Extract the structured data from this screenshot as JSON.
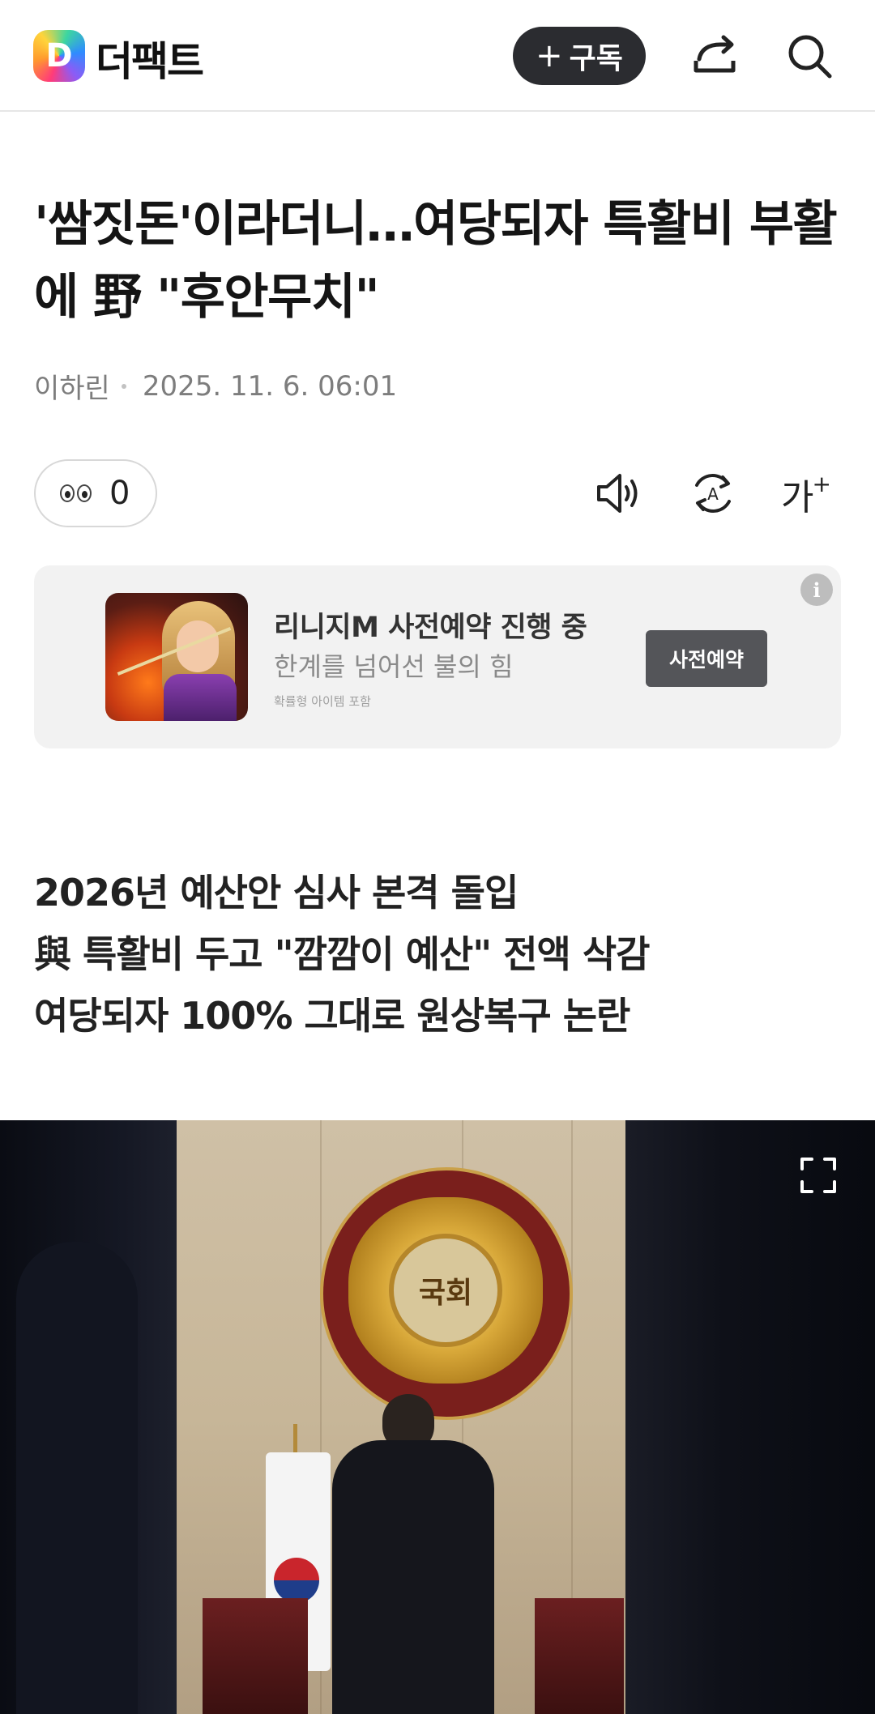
{
  "header": {
    "logo_letter": "D",
    "logo_text": "더팩트",
    "subscribe_label": "구독",
    "icons": [
      "share-icon",
      "search-icon"
    ]
  },
  "article": {
    "title": "'쌈짓돈'이라더니…여당되자 특활비 부활에 野 \"후안무치\"",
    "author": "이하린",
    "date": "2025. 11. 6. 06:01",
    "reaction_count": "0",
    "tools": [
      "speaker-icon",
      "translate-icon",
      "font-size-icon"
    ],
    "font_size_label": "가"
  },
  "ad": {
    "title": "리니지M 사전예약 진행 중",
    "subtitle": "한계를 넘어선 불의 힘",
    "note": "확률형 아이템 포함",
    "cta": "사전예약",
    "info": "i"
  },
  "summary": [
    "2026년 예산안 심사 본격 돌입",
    "與 특활비 두고 \"깜깜이 예산\" 전액 삭감",
    "여당되자 100% 그대로 원상복구 논란"
  ],
  "photo": {
    "emblem_text": "국회"
  }
}
